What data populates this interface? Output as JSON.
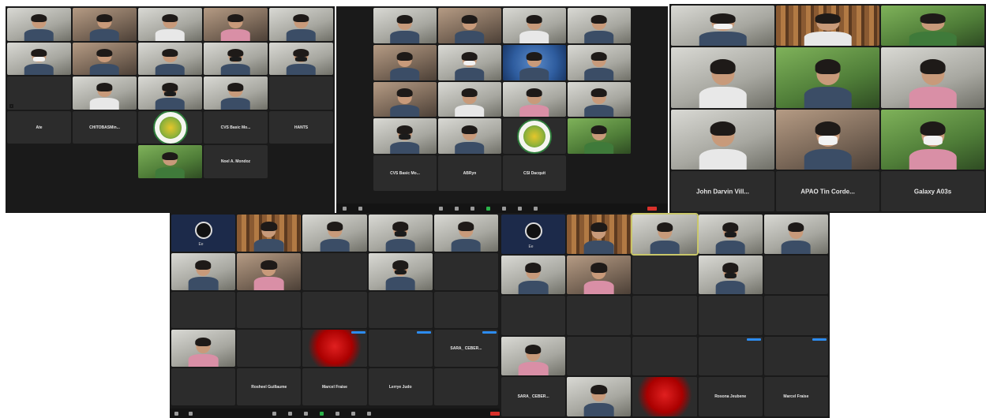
{
  "colors": {
    "meeting_bg": "#1a1a1a",
    "tile_empty": "#2c2c2c",
    "active_speaker": "#c9c76a",
    "end_button": "#d9312b",
    "unmute": "#2bb34a",
    "label_badge": "#2d8cf0"
  },
  "screenshot_1": {
    "names": {
      "mid_row_1": "Ate",
      "mid_row_2": "CHITOBASMin...",
      "mid_row_4": "CVS Basic Mo...",
      "mid_row_5": "HANTS",
      "bottom": "Noel A. Mondoz"
    }
  },
  "screenshot_2": {
    "names": {
      "bottom_1": "CVS Basic Mo...",
      "bottom_2": "ABRyn",
      "bottom_3": "CSI Dacquit"
    }
  },
  "screenshot_3": {
    "names": {
      "bottom_1": "John Darvin Vill...",
      "bottom_2": "APAO Tin Corde...",
      "bottom_3": "Galaxy A03s"
    }
  },
  "screenshot_4": {
    "names": {
      "obs_label": "Ee",
      "mid_row": "SARA_ CEBER...",
      "bottom_1": "Rosheel Guillaume",
      "bottom_2": "Marcel Fraise",
      "bottom_3": "Lerrye Judo"
    }
  },
  "screenshot_5": {
    "names": {
      "obs_label": "Ee",
      "bottom_1": "SARA_ CEBER...",
      "bottom_2": "Rosona Jeubene",
      "bottom_3": "Marcel Fraise"
    }
  }
}
